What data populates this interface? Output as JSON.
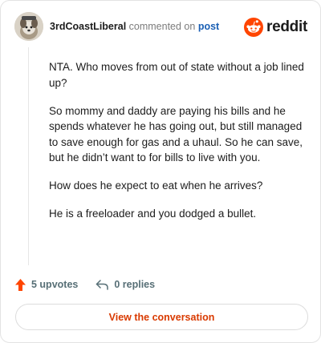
{
  "comment": {
    "username": "3rdCoastLiberal",
    "verb": "commented on",
    "post_link": "post",
    "paragraphs": [
      "NTA. Who moves from out of state without a job lined up?",
      "So mommy and daddy are paying his bills and he spends whatever he has going out, but still managed to save enough for gas and a uhaul. So he can save, but he didn’t want to for bills to live with you.",
      "How does he expect to eat when he arrives?",
      "He is a freeloader and you dodged a bullet."
    ],
    "upvotes_label": "5 upvotes",
    "replies_label": "0 replies"
  },
  "brand": {
    "wordmark": "reddit",
    "icon": "reddit-snoo-icon",
    "color": "#ff4500"
  },
  "cta": {
    "label": "View the conversation",
    "color": "#d93a00"
  },
  "icons": {
    "upvote": "upvote-arrow-icon",
    "reply": "reply-arrow-icon"
  },
  "colors": {
    "upvote": "#ff4500",
    "post_link": "#1a5fb4",
    "muted": "#576f76"
  }
}
